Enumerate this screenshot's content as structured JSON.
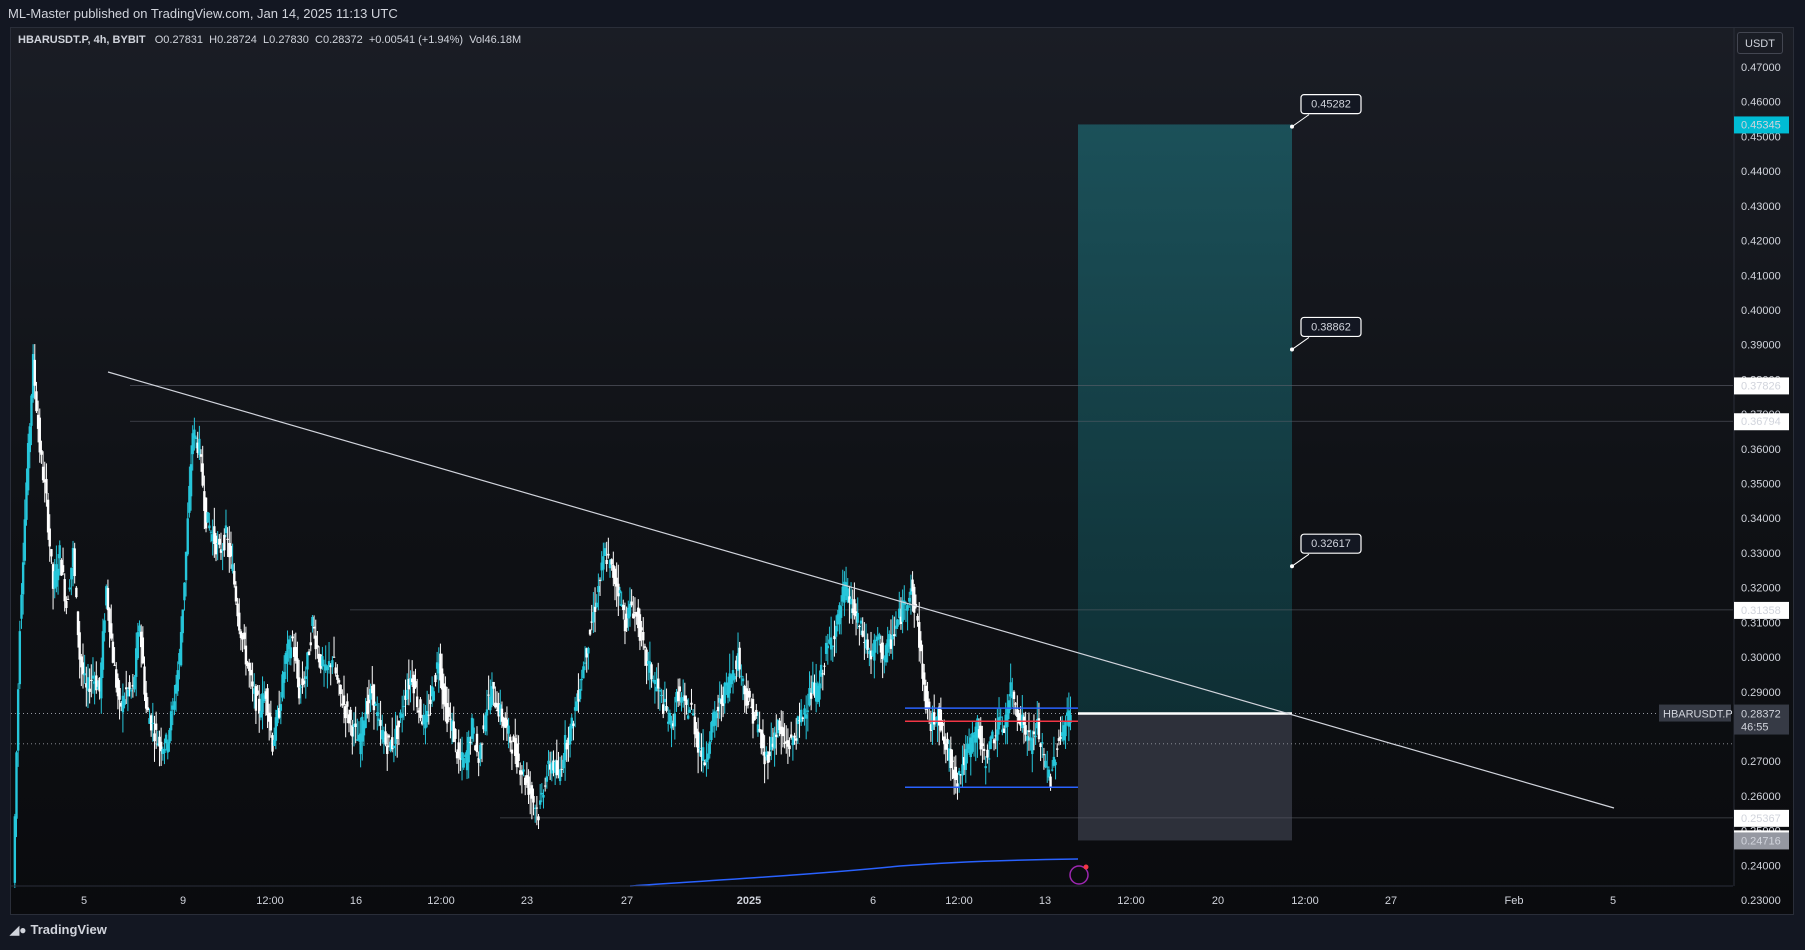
{
  "header": {
    "published": "ML-Master published on TradingView.com, Jan 14, 2025 11:13 UTC"
  },
  "legend": {
    "symbol": "HBARUSDT.P, 4h, BYBIT",
    "open_label": "O",
    "open": "0.27831",
    "high_label": "H",
    "high": "0.28724",
    "low_label": "L",
    "low": "0.27830",
    "close_label": "C",
    "close": "0.28372",
    "change": "+0.00541 (+1.94%)",
    "vol_label": "Vol",
    "vol": "46.18M"
  },
  "currency": "USDT",
  "footer": {
    "brand": "TradingView"
  },
  "colors": {
    "up": "#26c6da",
    "down": "#ffffff",
    "target_zone": "#1c5a63",
    "stop_zone": "#363a45",
    "trendline": "#d1d4dc",
    "range_box": "#2962ff",
    "entry_line": "#f23645",
    "ma_line": "#2962ff"
  },
  "chart_data": {
    "type": "candlestick",
    "symbol": "HBARUSDT.P",
    "interval": "4h",
    "exchange": "BYBIT",
    "ylim": [
      0.225,
      0.4745
    ],
    "y_ticks": [
      "0.47000",
      "0.46000",
      "0.45000",
      "0.44000",
      "0.43000",
      "0.42000",
      "0.41000",
      "0.40000",
      "0.39000",
      "0.38000",
      "0.37000",
      "0.36000",
      "0.35000",
      "0.34000",
      "0.33000",
      "0.32000",
      "0.31000",
      "0.30000",
      "0.29000",
      "0.28000",
      "0.27000",
      "0.26000",
      "0.25000",
      "0.24000",
      "0.23000"
    ],
    "x_ticks": [
      "5",
      "9",
      "12:00",
      "16",
      "12:00",
      "23",
      "27",
      "2025",
      "6",
      "12:00",
      "13",
      "12:00",
      "20",
      "12:00",
      "27",
      "Feb",
      "5"
    ],
    "price_labels": [
      {
        "value": "0.45345",
        "style": "cyan"
      },
      {
        "value": "0.37826",
        "style": "white"
      },
      {
        "value": "0.36794",
        "style": "white"
      },
      {
        "value": "0.31358",
        "style": "white"
      },
      {
        "value": "0.28382",
        "style": "white"
      },
      {
        "value": "0.28372",
        "style": "gray",
        "symbol": "HBARUSDT.P",
        "countdown": "46:55"
      },
      {
        "value": "0.25367",
        "style": "white"
      },
      {
        "value": "0.24776",
        "style": "white"
      },
      {
        "value": "0.24716",
        "style": "gray"
      }
    ],
    "targets": [
      "0.45282",
      "0.38862",
      "0.32617"
    ],
    "series": [
      {
        "name": "price_path",
        "values": [
          0.235,
          0.31,
          0.35,
          0.385,
          0.36,
          0.345,
          0.32,
          0.33,
          0.315,
          0.33,
          0.3,
          0.29,
          0.295,
          0.29,
          0.32,
          0.3,
          0.285,
          0.29,
          0.29,
          0.31,
          0.285,
          0.28,
          0.275,
          0.275,
          0.285,
          0.3,
          0.33,
          0.365,
          0.36,
          0.34,
          0.335,
          0.33,
          0.335,
          0.325,
          0.31,
          0.3,
          0.29,
          0.285,
          0.29,
          0.275,
          0.285,
          0.3,
          0.305,
          0.29,
          0.295,
          0.31,
          0.3,
          0.295,
          0.3,
          0.29,
          0.285,
          0.28,
          0.275,
          0.285,
          0.29,
          0.28,
          0.275,
          0.275,
          0.28,
          0.29,
          0.295,
          0.285,
          0.28,
          0.29,
          0.3,
          0.285,
          0.28,
          0.27,
          0.27,
          0.28,
          0.27,
          0.285,
          0.29,
          0.285,
          0.28,
          0.275,
          0.27,
          0.265,
          0.26,
          0.255,
          0.265,
          0.27,
          0.265,
          0.275,
          0.28,
          0.29,
          0.3,
          0.31,
          0.32,
          0.33,
          0.325,
          0.32,
          0.31,
          0.315,
          0.31,
          0.3,
          0.295,
          0.29,
          0.285,
          0.28,
          0.29,
          0.285,
          0.285,
          0.275,
          0.27,
          0.28,
          0.285,
          0.29,
          0.295,
          0.3,
          0.29,
          0.285,
          0.28,
          0.27,
          0.275,
          0.28,
          0.275,
          0.275,
          0.28,
          0.285,
          0.29,
          0.29,
          0.3,
          0.305,
          0.31,
          0.32,
          0.315,
          0.31,
          0.305,
          0.3,
          0.305,
          0.3,
          0.305,
          0.31,
          0.315,
          0.32,
          0.31,
          0.29,
          0.28,
          0.285,
          0.275,
          0.27,
          0.265,
          0.27,
          0.275,
          0.28,
          0.27,
          0.275,
          0.28,
          0.28,
          0.29,
          0.285,
          0.28,
          0.275,
          0.28,
          0.27,
          0.265,
          0.275,
          0.28,
          0.284
        ]
      }
    ]
  }
}
